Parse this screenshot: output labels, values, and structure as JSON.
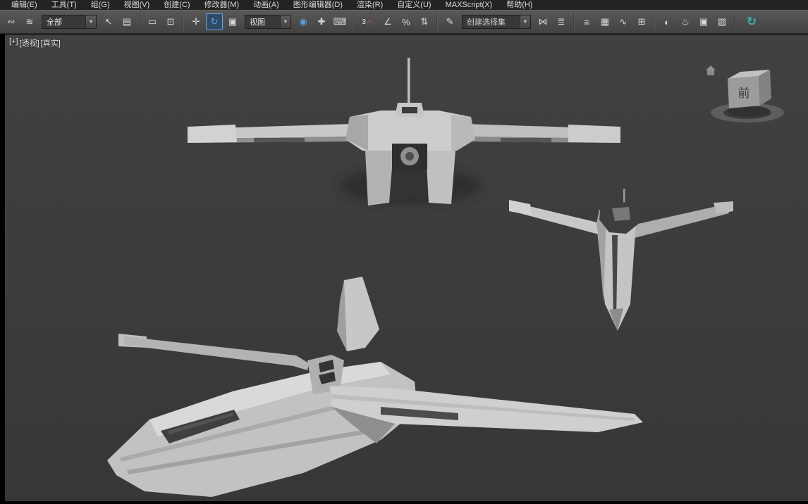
{
  "colors": {
    "menubar_bg": "#232323",
    "toolbar_bg": "#4b4b4b",
    "viewport_bg": "#3b3b3b",
    "accent_blue": "#5aa0e0",
    "magnet_red": "#c65b4e",
    "refresh_teal": "#35b0a8",
    "model_gray": "#c6c6c6"
  },
  "menu": {
    "items": [
      {
        "label": "编辑(E)"
      },
      {
        "label": "工具(T)"
      },
      {
        "label": "组(G)"
      },
      {
        "label": "视图(V)"
      },
      {
        "label": "创建(C)"
      },
      {
        "label": "修改器(M)"
      },
      {
        "label": "动画(A)"
      },
      {
        "label": "图形编辑器(D)"
      },
      {
        "label": "渲染(R)"
      },
      {
        "label": "自定义(U)"
      },
      {
        "label": "MAXScript(X)"
      },
      {
        "label": "帮助(H)"
      }
    ]
  },
  "toolbar": {
    "selection_filter_value": "全部",
    "coordinate_system_value": "视图",
    "named_selection_value": "创建选择集",
    "snap_mode": "3",
    "chevron_down": "▼",
    "icons": [
      {
        "name": "select-and-link-icon",
        "glyph": "∾"
      },
      {
        "name": "bind-to-space-warp-icon",
        "glyph": "≋"
      },
      {
        "name": "select-object-icon",
        "glyph": "↖"
      },
      {
        "name": "select-by-name-icon",
        "glyph": "▤"
      },
      {
        "name": "rectangular-selection-region-icon",
        "glyph": "▭"
      },
      {
        "name": "window-crossing-icon",
        "glyph": "⊡"
      },
      {
        "name": "select-and-move-icon",
        "glyph": "✛"
      },
      {
        "name": "select-and-rotate-icon",
        "glyph": "↻"
      },
      {
        "name": "select-and-scale-icon",
        "glyph": "▣"
      },
      {
        "name": "use-pivot-point-icon",
        "glyph": "◉"
      },
      {
        "name": "select-and-manipulate-icon",
        "glyph": "✚"
      },
      {
        "name": "keyboard-override-icon",
        "glyph": "⌨"
      },
      {
        "name": "snap-magnet-icon",
        "glyph": "∩"
      },
      {
        "name": "angle-snap-icon",
        "glyph": "∠"
      },
      {
        "name": "percent-snap-icon",
        "glyph": "%"
      },
      {
        "name": "spinner-snap-icon",
        "glyph": "⇅"
      },
      {
        "name": "edit-named-selection-sets-icon",
        "glyph": "✎"
      },
      {
        "name": "mirror-icon",
        "glyph": "⋈"
      },
      {
        "name": "align-icon",
        "glyph": "≣"
      },
      {
        "name": "layer-manager-icon",
        "glyph": "≡"
      },
      {
        "name": "scene-explorer-icon",
        "glyph": "▦"
      },
      {
        "name": "curve-editor-icon",
        "glyph": "∿"
      },
      {
        "name": "schematic-view-icon",
        "glyph": "⊞"
      },
      {
        "name": "material-editor-icon",
        "glyph": "◐"
      },
      {
        "name": "render-setup-icon",
        "glyph": "♨"
      },
      {
        "name": "rendered-frame-window-icon",
        "glyph": "▣"
      },
      {
        "name": "render-production-icon",
        "glyph": "▨"
      },
      {
        "name": "refresh-icon",
        "glyph": "↻"
      }
    ]
  },
  "viewport": {
    "label_menu": "[+]",
    "label_pov": "[透视]",
    "label_shading": "[真实]",
    "viewcube_front_label": "前"
  }
}
